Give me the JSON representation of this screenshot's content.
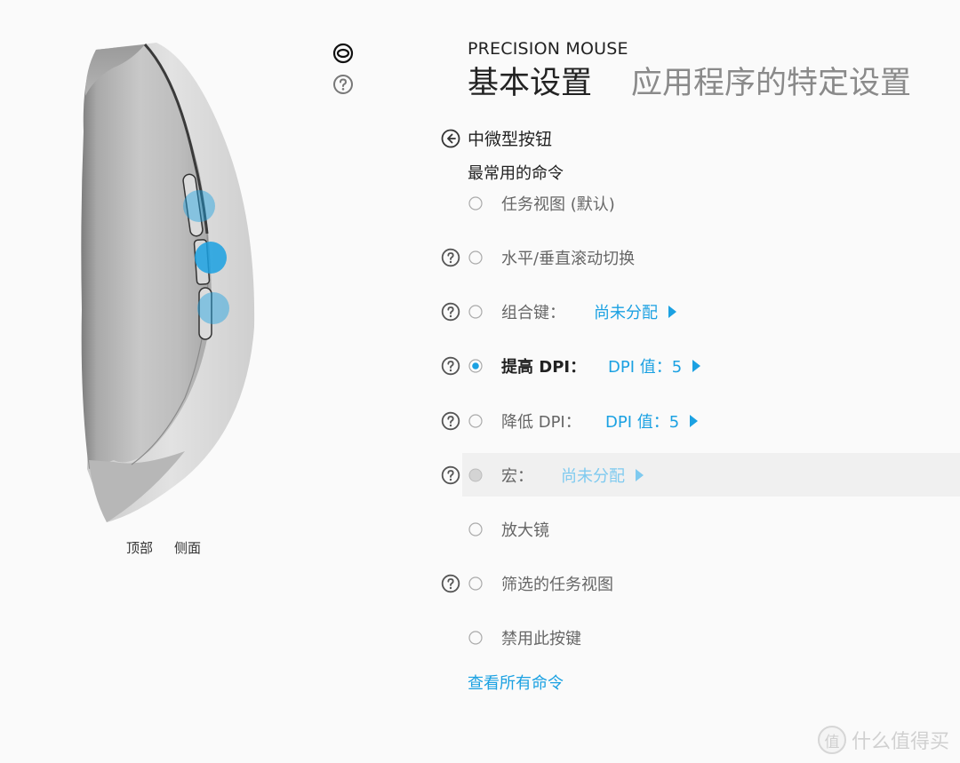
{
  "device": {
    "name": "PRECISION MOUSE"
  },
  "tabs": [
    {
      "label": "基本设置",
      "active": true
    },
    {
      "label": "应用程序的特定设置",
      "active": false
    }
  ],
  "side_icons": [
    {
      "name": "eye-icon"
    },
    {
      "name": "help-icon"
    }
  ],
  "mouse_view": {
    "view_tabs": [
      "顶部",
      "侧面"
    ],
    "hotspot_color": "#1ba1e2"
  },
  "panel": {
    "back_title": "中微型按钮",
    "section_label": "最常用的命令",
    "see_all_label": "查看所有命令",
    "options": [
      {
        "label": "任务视图 (默认)",
        "help": false,
        "selected": false,
        "disabled": false,
        "value": null
      },
      {
        "label": "水平/垂直滚动切换",
        "help": true,
        "selected": false,
        "disabled": false,
        "value": null
      },
      {
        "label": "组合键：",
        "help": true,
        "selected": false,
        "disabled": false,
        "value": "尚未分配"
      },
      {
        "label": "提高 DPI：",
        "help": true,
        "selected": true,
        "disabled": false,
        "value": "DPI 值：5"
      },
      {
        "label": "降低 DPI：",
        "help": true,
        "selected": false,
        "disabled": false,
        "value": "DPI 值：5"
      },
      {
        "label": "宏：",
        "help": true,
        "selected": false,
        "disabled": true,
        "value": "尚未分配"
      },
      {
        "label": "放大镜",
        "help": false,
        "selected": false,
        "disabled": false,
        "value": null
      },
      {
        "label": "筛选的任务视图",
        "help": true,
        "selected": false,
        "disabled": false,
        "value": null
      },
      {
        "label": "禁用此按键",
        "help": false,
        "selected": false,
        "disabled": false,
        "value": null
      }
    ]
  },
  "colors": {
    "accent": "#1ba1e2",
    "accent_disabled": "#7fcaef",
    "background": "#fafafa",
    "disabled_row": "#f0f0f0"
  },
  "watermark": {
    "badge": "值",
    "text": "什么值得买"
  }
}
